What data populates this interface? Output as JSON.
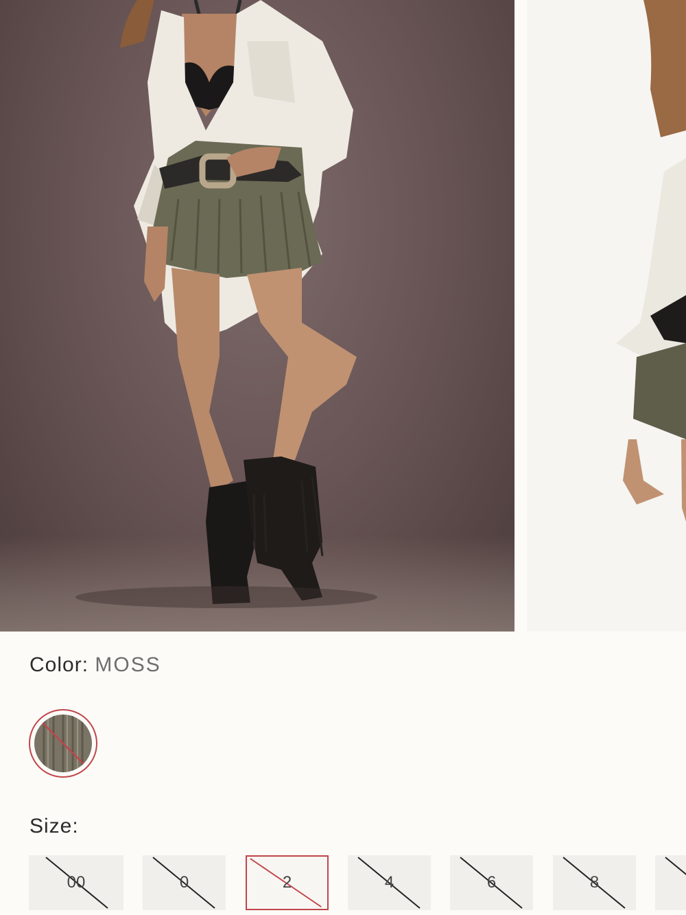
{
  "color": {
    "label": "Color:",
    "value": "MOSS",
    "swatch_color": "#7a7466"
  },
  "size": {
    "label": "Size:",
    "options": [
      "00",
      "0",
      "2",
      "4",
      "6",
      "8",
      ""
    ],
    "selected": "2",
    "unavailable_color": "#222222",
    "selected_color": "#c0454a"
  },
  "colors": {
    "background": "#fcfbf7",
    "accent": "#c0454a",
    "button_bg": "#f0efeb"
  }
}
